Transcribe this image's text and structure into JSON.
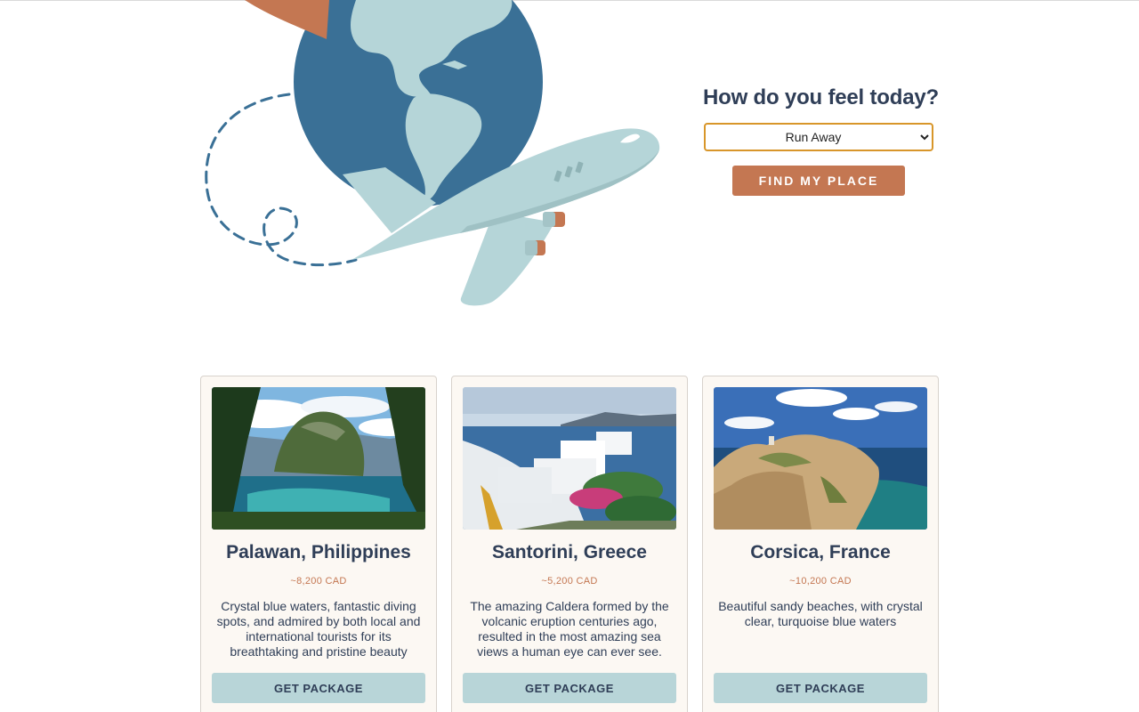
{
  "mood": {
    "heading": "How do you feel today?",
    "selected": "Run Away",
    "button": "FIND MY PLACE"
  },
  "cards": [
    {
      "title": "Palawan, Philippines",
      "price": "~8,200 CAD",
      "description": "Crystal blue waters, fantastic diving spots, and admired by both local and international tourists for its breathtaking and pristine beauty",
      "button": "GET PACKAGE"
    },
    {
      "title": "Santorini, Greece",
      "price": "~5,200 CAD",
      "description": "The amazing Caldera formed by the volcanic eruption centuries ago, resulted in the most amazing sea views a human eye can ever see.",
      "button": "GET PACKAGE"
    },
    {
      "title": "Corsica, France",
      "price": "~10,200 CAD",
      "description": "Beautiful sandy beaches, with crystal clear, turquoise blue waters",
      "button": "GET PACKAGE"
    }
  ],
  "colors": {
    "navy": "#2f3e57",
    "terracotta": "#c47752",
    "globe": "#3a7096",
    "plane": "#b5d5d8",
    "card_bg": "#fcf8f3",
    "select_border": "#d8962a"
  },
  "icons": {
    "hero": "globe-with-airplane-illustration"
  }
}
